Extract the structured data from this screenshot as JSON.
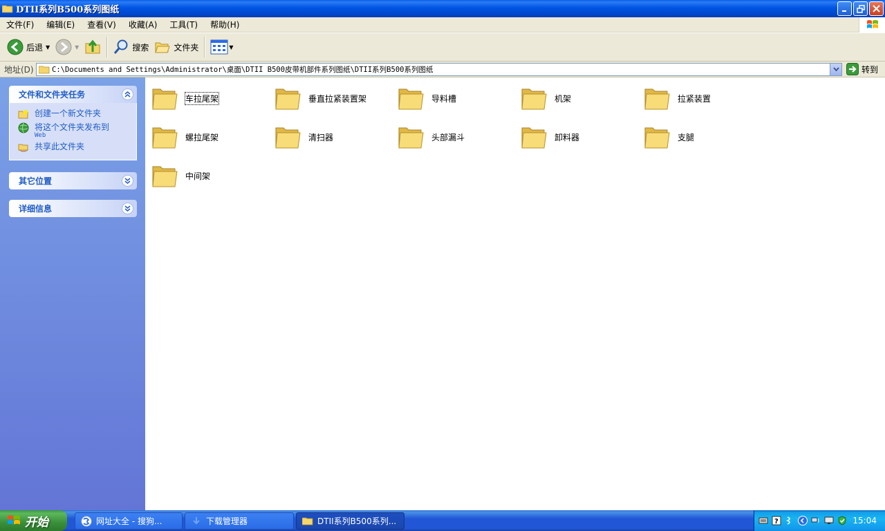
{
  "window": {
    "title": "DTII系列B500系列图纸"
  },
  "menu": {
    "items": [
      "文件(F)",
      "编辑(E)",
      "查看(V)",
      "收藏(A)",
      "工具(T)",
      "帮助(H)"
    ]
  },
  "toolbar": {
    "back_label": "后退",
    "search_label": "搜索",
    "folders_label": "文件夹"
  },
  "address": {
    "label": "地址(D)",
    "path": "C:\\Documents and Settings\\Administrator\\桌面\\DTII B500皮带机部件系列图纸\\DTII系列B500系列图纸",
    "go_label": "转到"
  },
  "taskpane": {
    "tasks_title": "文件和文件夹任务",
    "tasks": [
      {
        "label": "创建一个新文件夹",
        "sub": ""
      },
      {
        "label": "将这个文件夹发布到",
        "sub": "Web"
      },
      {
        "label": "共享此文件夹",
        "sub": ""
      }
    ],
    "other_places_title": "其它位置",
    "details_title": "详细信息"
  },
  "folders": [
    "车拉尾架",
    "垂直拉紧装置架",
    "导料槽",
    "机架",
    "拉紧装置",
    "螺拉尾架",
    "清扫器",
    "头部漏斗",
    "卸料器",
    "支腿",
    "中间架"
  ],
  "taskbar": {
    "start_label": "开始",
    "buttons": [
      "网址大全 - 搜狗...",
      "下载管理器",
      "DTII系列B500系列..."
    ],
    "clock": "15:04"
  },
  "colors": {
    "title_bar": "#0054e3",
    "taskpane_link": "#215dc6",
    "folder_yellow": "#f5d66b"
  }
}
